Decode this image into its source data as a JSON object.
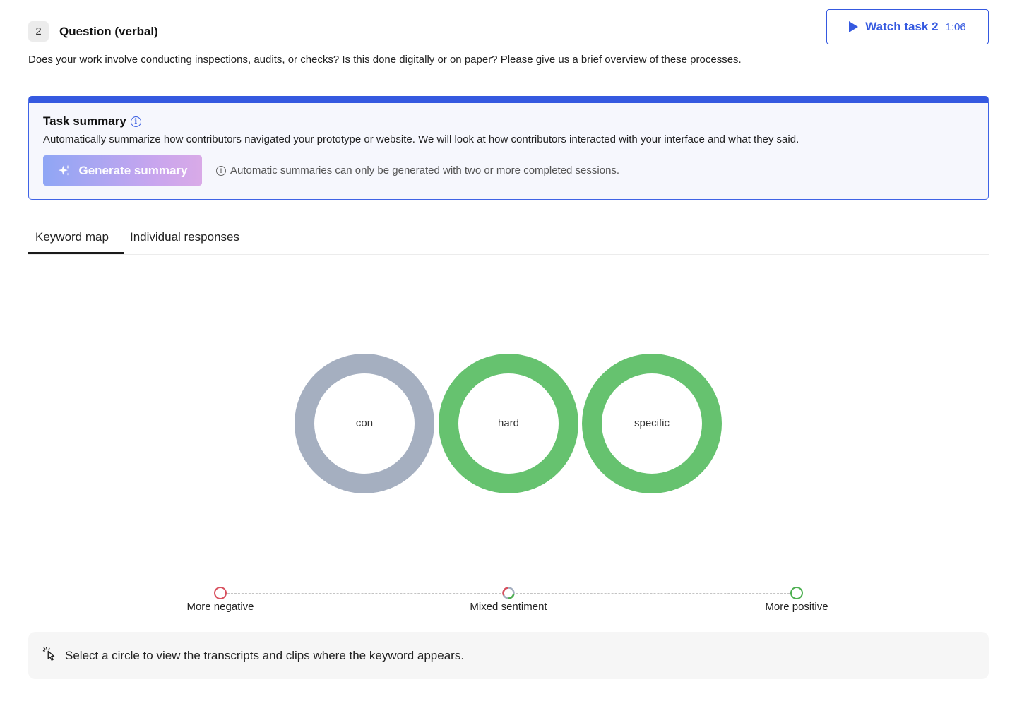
{
  "header": {
    "task_number": "2",
    "title": "Question (verbal)",
    "question": "Does your work involve conducting inspections, audits, or checks? Is this done digitally or on paper? Please give us a brief overview of these processes.",
    "watch_label": "Watch task 2",
    "watch_duration": "1:06"
  },
  "summary": {
    "title": "Task summary",
    "description": "Automatically summarize how contributors navigated your prototype or website. We will look at how contributors interacted with your interface and what they said.",
    "generate_label": "Generate summary",
    "note": "Automatic summaries can only be generated with two or more completed sessions."
  },
  "tabs": [
    {
      "label": "Keyword map",
      "active": true
    },
    {
      "label": "Individual responses",
      "active": false
    }
  ],
  "keywords": [
    {
      "word": "con",
      "sentiment": "neutral",
      "color": "#a5afc0"
    },
    {
      "word": "hard",
      "sentiment": "positive",
      "color": "#66c26f"
    },
    {
      "word": "specific",
      "sentiment": "positive",
      "color": "#66c26f"
    }
  ],
  "legend": {
    "negative": {
      "label": "More negative",
      "color": "#d8505e"
    },
    "mixed": {
      "label": "Mixed sentiment",
      "color": "#a5afc0"
    },
    "positive": {
      "label": "More positive",
      "color": "#4caf50"
    }
  },
  "hint": {
    "text": "Select a circle to view the transcripts and clips where the keyword appears."
  },
  "colors": {
    "accent": "#3559e0",
    "summary_bg": "#f6f7fd"
  }
}
